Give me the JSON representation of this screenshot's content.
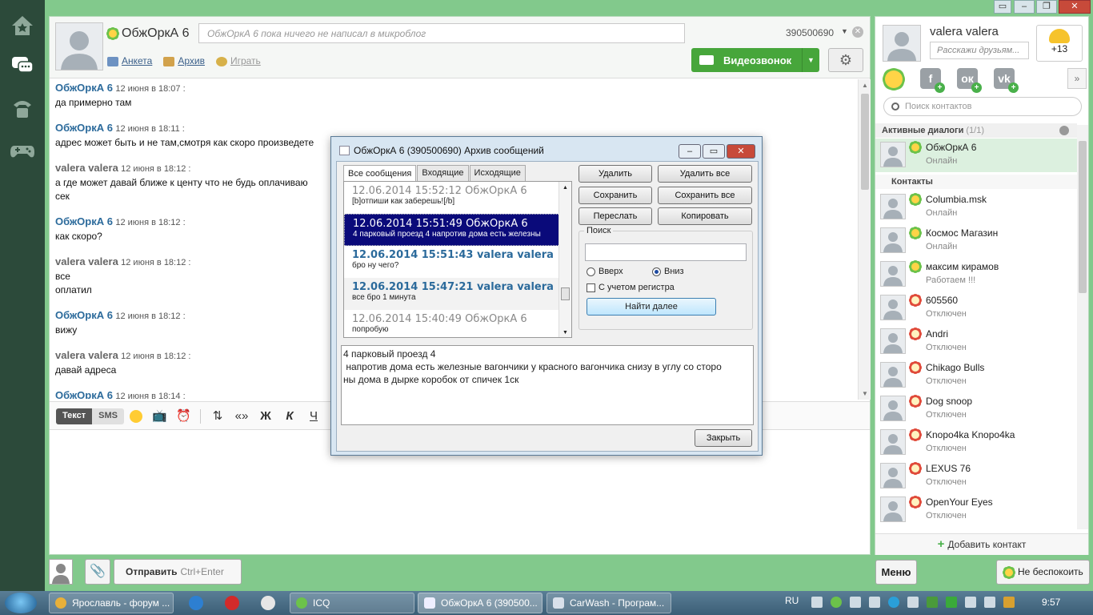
{
  "contact": {
    "name": "ОбжОркА 6",
    "microblog_placeholder": "ОбжОркА 6 пока ничего не написал в микроблог",
    "uin": "390500690",
    "links": [
      "Анкета",
      "Архив",
      "Играть"
    ],
    "videocall_label": "Видеозвонок"
  },
  "messages": [
    {
      "author": "ОбжОркА 6",
      "who": "them",
      "time": "12 июня в 18:07 :",
      "lines": [
        "да примерно там"
      ]
    },
    {
      "author": "ОбжОркА 6",
      "who": "them",
      "time": "12 июня в 18:11 :",
      "lines": [
        "адрес может быть и не там,смотря как скоро произведете"
      ]
    },
    {
      "author": "valera valera",
      "who": "me",
      "time": "12 июня в 18:12 :",
      "lines": [
        "а где может давай ближе к центу что не будь оплачиваю",
        "сек"
      ]
    },
    {
      "author": "ОбжОркА 6",
      "who": "them",
      "time": "12 июня в 18:12 :",
      "lines": [
        "как скоро?"
      ]
    },
    {
      "author": "valera valera",
      "who": "me",
      "time": "12 июня в 18:12 :",
      "lines": [
        "все",
        "оплатил"
      ]
    },
    {
      "author": "ОбжОркА 6",
      "who": "them",
      "time": "12 июня в 18:12 :",
      "lines": [
        "вижу"
      ]
    },
    {
      "author": "valera valera",
      "who": "me",
      "time": "12 июня в 18:12 :",
      "lines": [
        "давай адреса"
      ]
    },
    {
      "author": "ОбжОркА 6",
      "who": "them",
      "time": "12 июня в 18:14 :",
      "lines": [
        ""
      ]
    }
  ],
  "composer": {
    "mode_text": "Текст",
    "mode_sms": "SMS",
    "send_label": "Отправить",
    "send_hint": "Ctrl+Enter",
    "format_quote": "«»",
    "format_bold": "Ж",
    "format_italic": "К",
    "format_underline": "Ч"
  },
  "me": {
    "name": "valera valera",
    "status_placeholder": "Расскажи друзьям...",
    "weather": "+13"
  },
  "contacts_panel": {
    "search_placeholder": "Поиск контактов",
    "active_dialogs_label": "Активные диалоги",
    "active_dialogs_count": "(1/1)",
    "contacts_label": "Контакты",
    "add_contact": "Добавить контакт",
    "menu": "Меню",
    "dnd": "Не беспокоить",
    "active": [
      {
        "name": "ОбжОркА 6",
        "status": "Онлайн",
        "online": true
      }
    ],
    "contacts": [
      {
        "name": "Columbia.msk",
        "status": "Онлайн",
        "online": true
      },
      {
        "name": "Космос Магазин",
        "status": "Онлайн",
        "online": true
      },
      {
        "name": "максим кирамов",
        "status": "Работаем !!!",
        "online": true
      },
      {
        "name": "605560",
        "status": "Отключен",
        "online": false
      },
      {
        "name": "Andri",
        "status": "Отключен",
        "online": false
      },
      {
        "name": "Chikago Bulls",
        "status": "Отключен",
        "online": false
      },
      {
        "name": "Dog snoop",
        "status": "Отключен",
        "online": false
      },
      {
        "name": "Knopo4ka Knopo4ka",
        "status": "Отключен",
        "online": false
      },
      {
        "name": "LEXUS 76",
        "status": "Отключен",
        "online": false
      },
      {
        "name": "OpenYour Eyes",
        "status": "Отключен",
        "online": false
      }
    ]
  },
  "dialog": {
    "title": "ОбжОркА 6 (390500690) Архив сообщений",
    "tabs": [
      "Все сообщения",
      "Входящие",
      "Исходящие"
    ],
    "archive": [
      {
        "header": "12.06.2014 15:52:12 ОбжОркА 6",
        "body": "[b]отпиши как заберешь![/b]",
        "who": "them"
      },
      {
        "header": "12.06.2014 15:51:49 ОбжОркА 6",
        "body": "4 парковый проезд 4 напротив дома есть железны",
        "who": "sel"
      },
      {
        "header": "12.06.2014 15:51:43 valera valera",
        "body": "бро ну чего?",
        "who": "me"
      },
      {
        "header": "12.06.2014 15:47:21 valera valera",
        "body": "все бро 1 минута",
        "who": "me-alt"
      },
      {
        "header": "12.06.2014 15:40:49 ОбжОркА 6",
        "body": "попробую",
        "who": "them"
      }
    ],
    "buttons": {
      "delete": "Удалить",
      "delete_all": "Удалить все",
      "save": "Сохранить",
      "save_all": "Сохранить все",
      "forward": "Переслать",
      "copy": "Копировать",
      "find_next": "Найти далее",
      "close": "Закрыть"
    },
    "search_label": "Поиск",
    "radio_up": "Вверх",
    "radio_down": "Вниз",
    "case_sensitive": "С учетом регистра",
    "preview": "4 парковый проезд 4\n напротив дома есть железные вагончики у красного вагончика снизу в углу со сторо\nны дома в дырке коробок от спичек 1ск"
  },
  "taskbar": {
    "items": [
      "Ярославль - форум ...",
      "ICQ",
      "ОбжОркА 6 (390500...",
      "CarWash - Програм..."
    ],
    "lang": "RU",
    "time": "9:57"
  }
}
